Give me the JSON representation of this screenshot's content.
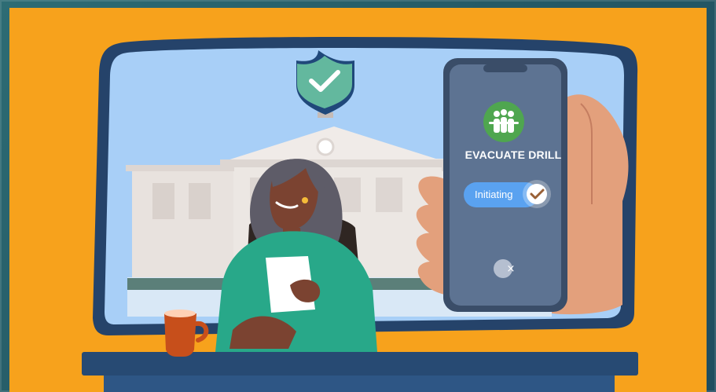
{
  "scene": {
    "colors": {
      "background": "#2f6670",
      "orange": "#f7a21c",
      "monitor_frame": "#25436a",
      "sky": "#a8cff7",
      "phone_body": "#5d7392",
      "phone_accent": "#4fa64f",
      "status_pill": "#5aa2f0",
      "shield": "#63b89e",
      "person_top": "#28a889"
    }
  },
  "phone": {
    "title": "EVACUATE DRILL",
    "status": "Initiating",
    "close_symbol": "×",
    "icons": {
      "title_icon": "evacuation-group-icon",
      "status_icon": "check-circle-icon",
      "close_icon": "close-icon"
    }
  },
  "shield": {
    "icon": "shield-check-icon"
  }
}
